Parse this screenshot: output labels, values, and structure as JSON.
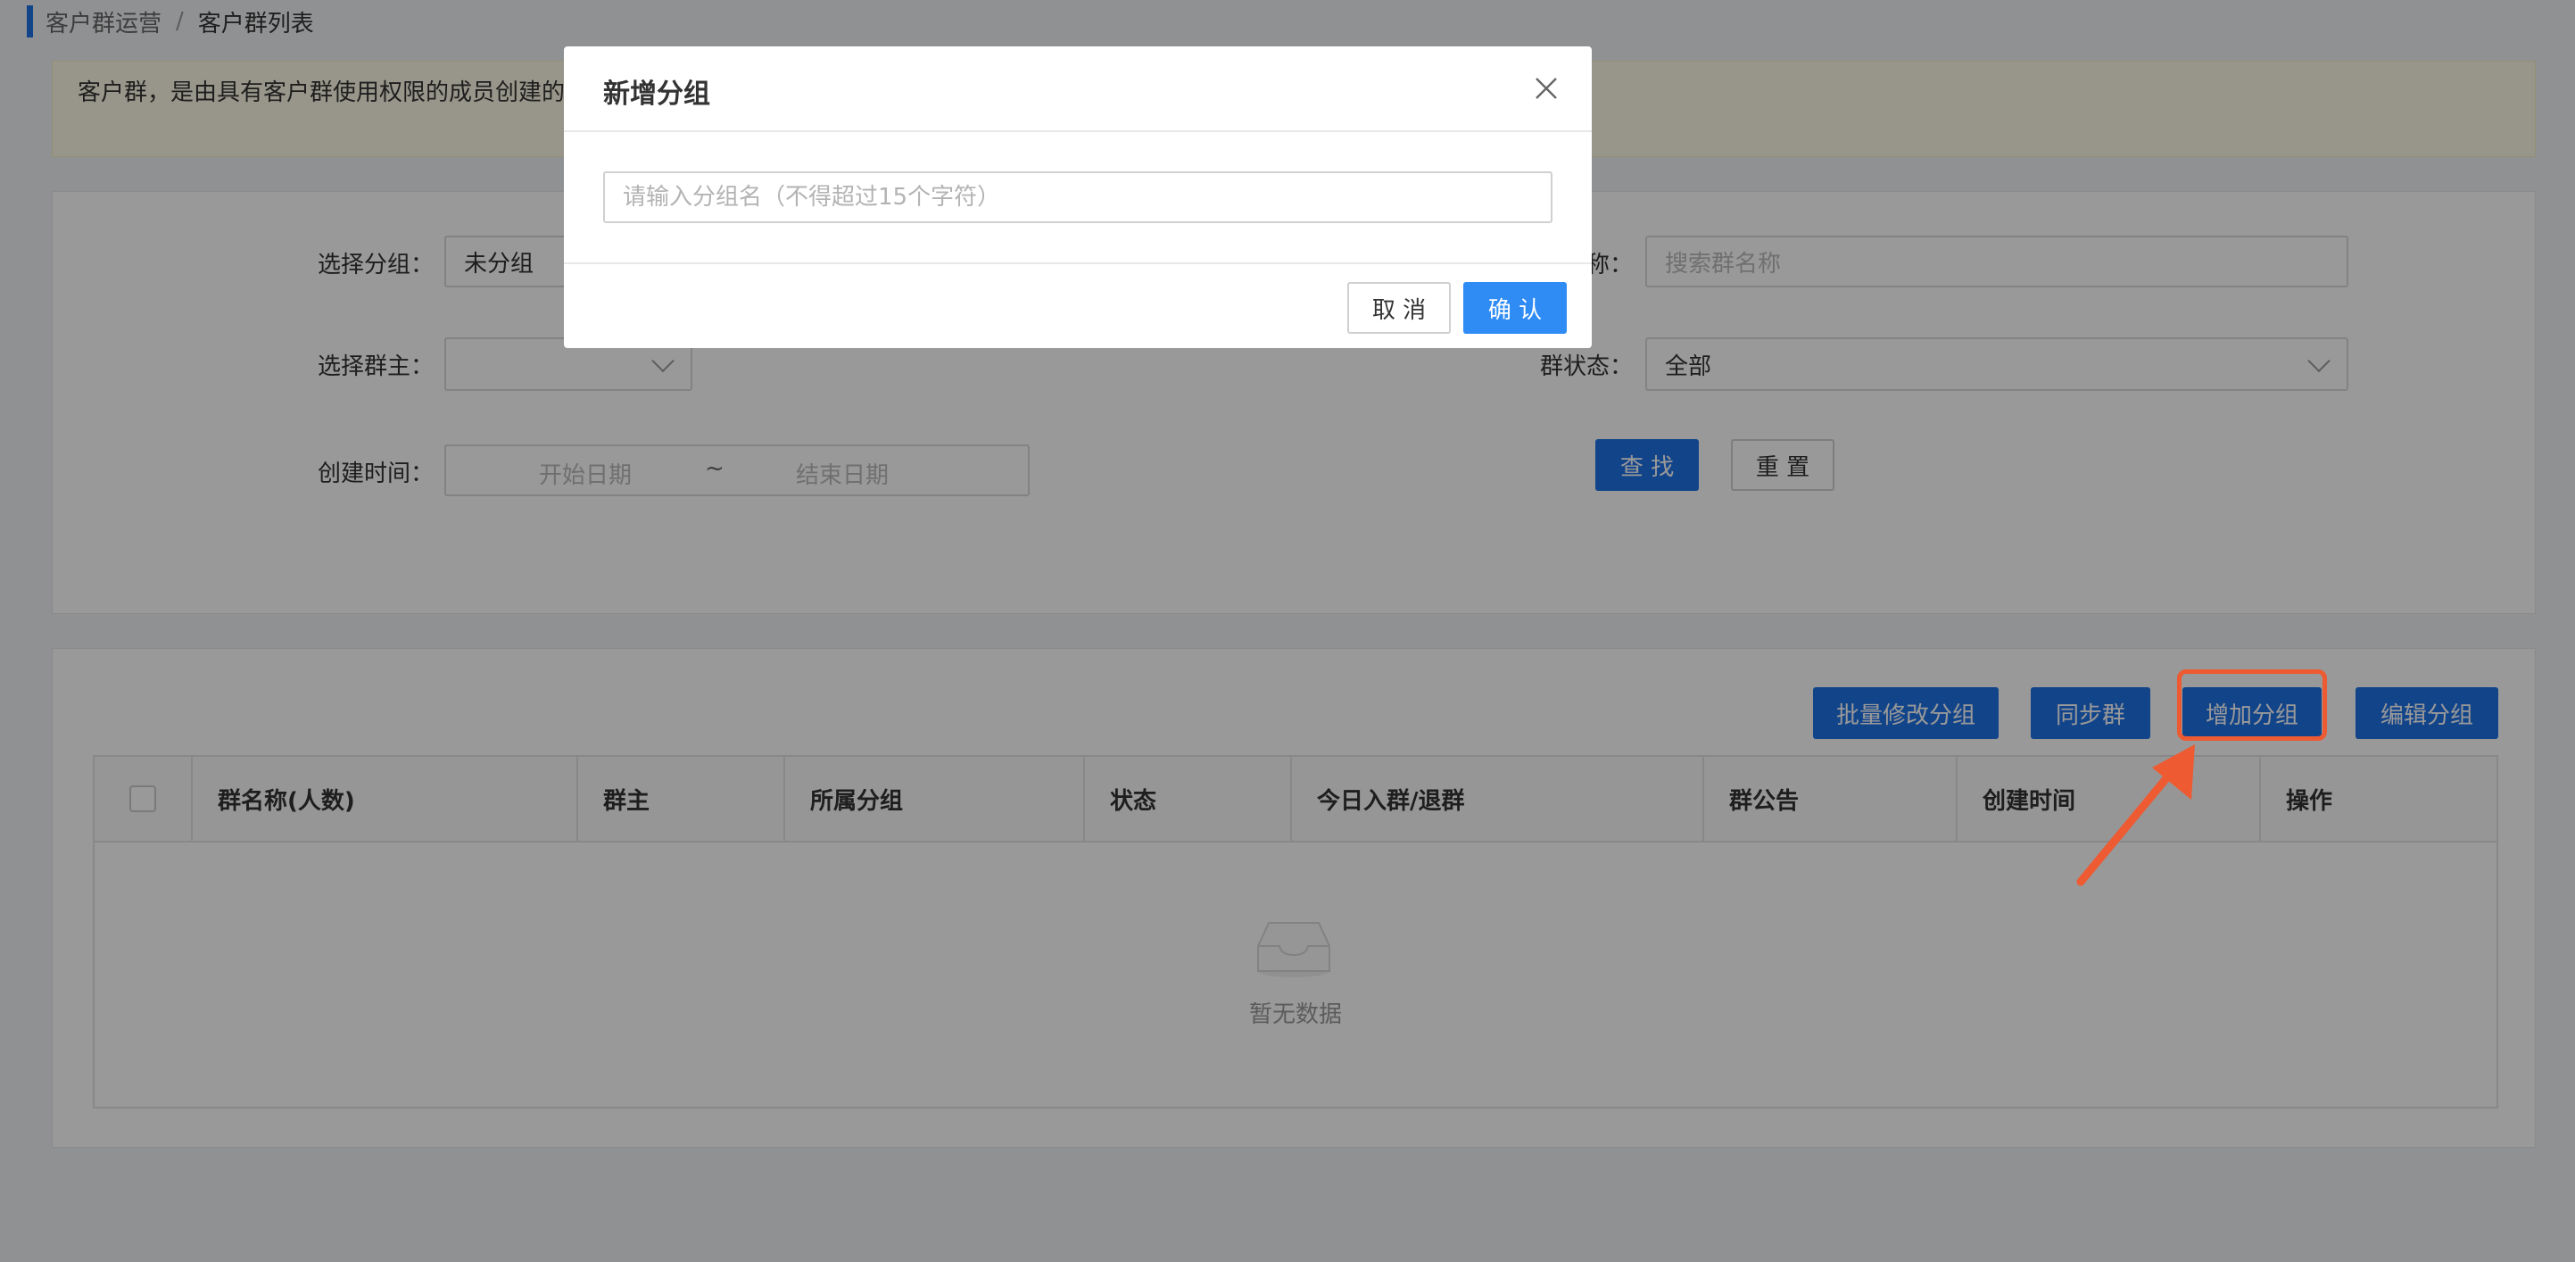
{
  "breadcrumb": {
    "parent": "客户群运营",
    "separator": "/",
    "current": "客户群列表"
  },
  "notice": {
    "text": "客户群，是由具有客户群使用权限的成员创建的外"
  },
  "filters": {
    "group_label": "选择分组：",
    "group_value": "未分组",
    "name_label": "名称：",
    "name_placeholder": "搜索群名称",
    "owner_label": "选择群主：",
    "owner_value": "",
    "status_label": "群状态：",
    "status_value": "全部",
    "created_label": "创建时间：",
    "start_placeholder": "开始日期",
    "range_sep": "~",
    "end_placeholder": "结束日期",
    "search_button": "查 找",
    "reset_button": "重 置"
  },
  "actions": {
    "batch_edit": "批量修改分组",
    "sync": "同步群",
    "add_group": "增加分组",
    "edit_group": "编辑分组"
  },
  "table": {
    "columns": [
      "群名称(人数)",
      "群主",
      "所属分组",
      "状态",
      "今日入群/退群",
      "群公告",
      "创建时间",
      "操作"
    ],
    "empty_text": "暂无数据"
  },
  "modal": {
    "title": "新增分组",
    "input_placeholder": "请输入分组名（不得超过15个字符）",
    "cancel": "取 消",
    "confirm": "确 认"
  },
  "colors": {
    "primary": "#1f72e6",
    "confirm": "#2f8cf5",
    "highlight": "#ee5a32"
  },
  "icons": {
    "close": "close-icon",
    "empty": "empty-box-icon",
    "dropdown": "chevron-down-icon",
    "arrow": "annotation-arrow-icon"
  }
}
